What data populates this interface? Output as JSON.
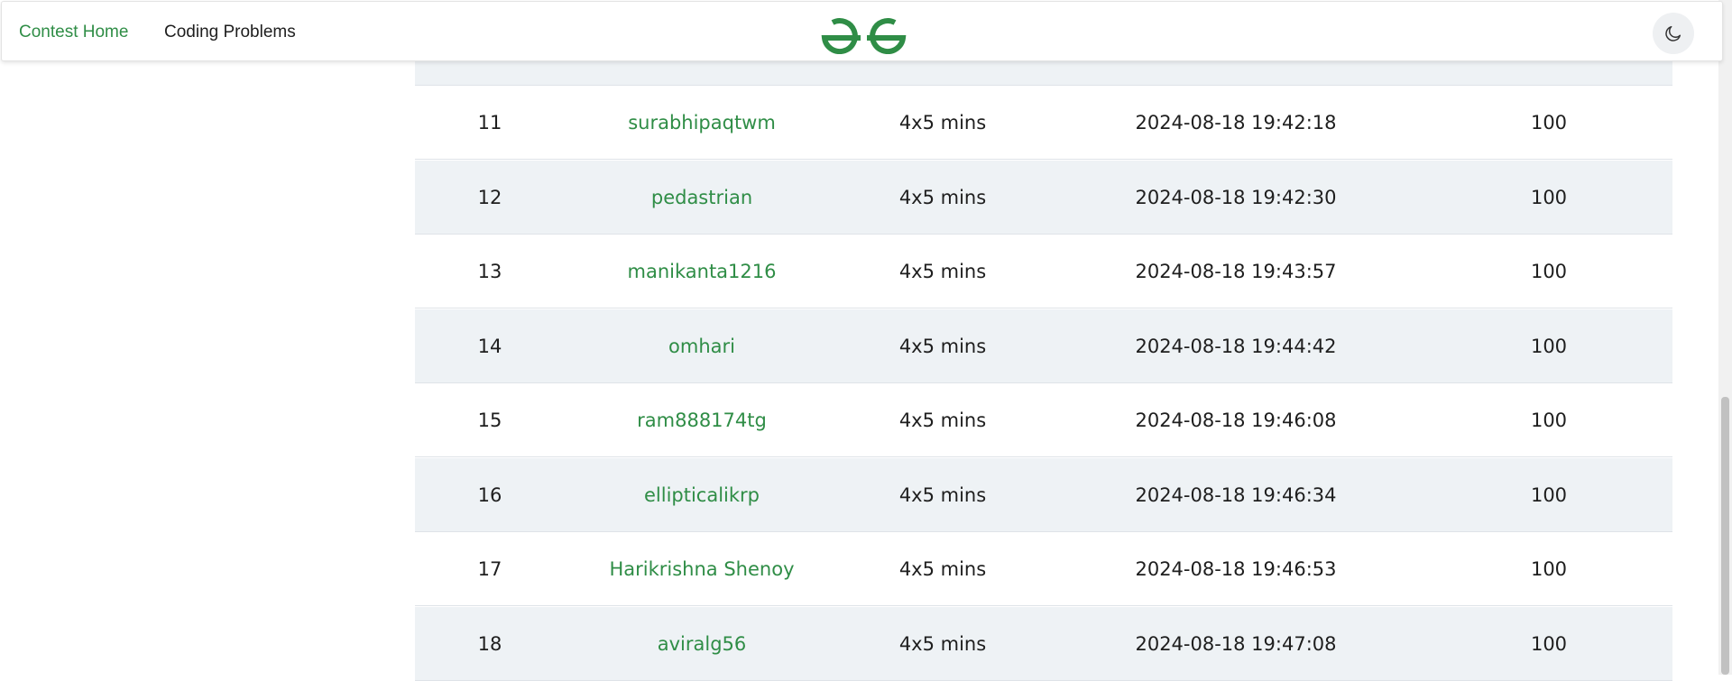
{
  "nav": {
    "home_label": "Contest Home",
    "problems_label": "Coding Problems",
    "logo_icon": "gfg-logo-icon",
    "theme_icon": "moon-icon",
    "brand_color": "#2f8d46"
  },
  "leaderboard": {
    "rows": [
      {
        "rank": "11",
        "user": "surabhipaqtwm",
        "time": "4x5 mins",
        "submitted": "2024-08-18 19:42:18",
        "score": "100"
      },
      {
        "rank": "12",
        "user": "pedastrian",
        "time": "4x5 mins",
        "submitted": "2024-08-18 19:42:30",
        "score": "100"
      },
      {
        "rank": "13",
        "user": "manikanta1216",
        "time": "4x5 mins",
        "submitted": "2024-08-18 19:43:57",
        "score": "100"
      },
      {
        "rank": "14",
        "user": "omhari",
        "time": "4x5 mins",
        "submitted": "2024-08-18 19:44:42",
        "score": "100"
      },
      {
        "rank": "15",
        "user": "ram888174tg",
        "time": "4x5 mins",
        "submitted": "2024-08-18 19:46:08",
        "score": "100"
      },
      {
        "rank": "16",
        "user": "ellipticalikrp",
        "time": "4x5 mins",
        "submitted": "2024-08-18 19:46:34",
        "score": "100"
      },
      {
        "rank": "17",
        "user": "Harikrishna Shenoy",
        "time": "4x5 mins",
        "submitted": "2024-08-18 19:46:53",
        "score": "100"
      },
      {
        "rank": "18",
        "user": "aviralg56",
        "time": "4x5 mins",
        "submitted": "2024-08-18 19:47:08",
        "score": "100"
      }
    ]
  }
}
